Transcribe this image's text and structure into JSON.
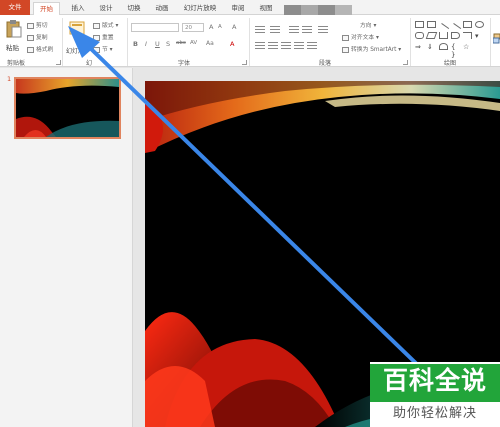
{
  "tabs": [
    {
      "label": "文件"
    },
    {
      "label": "开始"
    },
    {
      "label": "插入"
    },
    {
      "label": "设计"
    },
    {
      "label": "切换"
    },
    {
      "label": "动画"
    },
    {
      "label": "幻灯片放映"
    },
    {
      "label": "审阅"
    },
    {
      "label": "视图"
    }
  ],
  "active_tab": "开始",
  "ribbon": {
    "clipboard": {
      "paste": "粘贴",
      "cut": "剪切",
      "copy": "复制",
      "format_painter": "格式刷",
      "group": "剪贴板"
    },
    "slides": {
      "new_slide": "幻灯片",
      "layout": "版式",
      "reset": "重置",
      "section": "节",
      "group_partial": "幻"
    },
    "font": {
      "size": "20",
      "bold": "B",
      "italic": "I",
      "underline": "U",
      "strike": "S",
      "shadow": "abc",
      "spacing": "AV",
      "case": "Aa",
      "color": "A",
      "grow": "A",
      "shrink": "A",
      "clear": "A",
      "group": "字体"
    },
    "paragraph": {
      "direction": "方向",
      "align_text": "对齐文本",
      "smartart": "转换为 SmartArt",
      "group": "段落"
    },
    "drawing": {
      "group": "绘图"
    }
  },
  "slide_panel": {
    "slide_number": "1"
  },
  "watermark": {
    "title": "百科全说",
    "subtitle": "助你轻松解决"
  },
  "colors": {
    "accent": "#d24726",
    "arrow": "#3a86e8",
    "watermark_green": "#22a53a"
  }
}
